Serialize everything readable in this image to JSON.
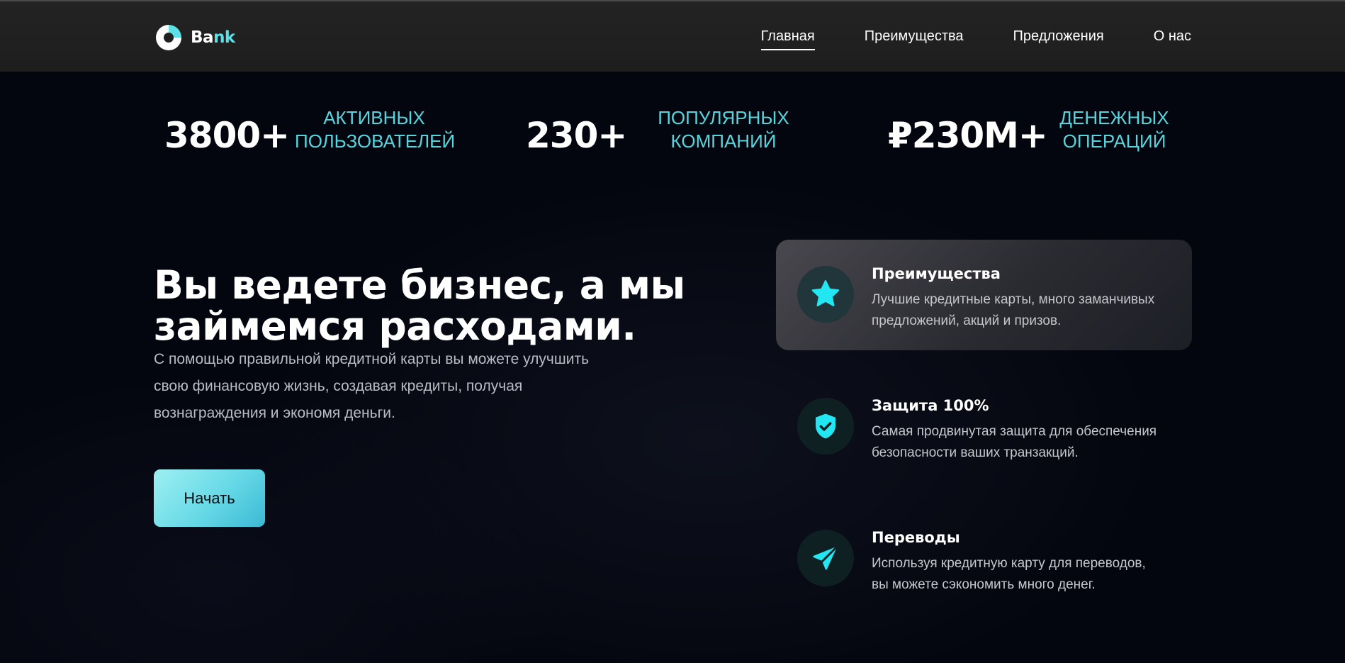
{
  "header": {
    "logo": {
      "text_part1": "Ba",
      "text_part2": "nk",
      "icon": "bank-logo-icon"
    },
    "nav": [
      {
        "label": "Главная",
        "active": true
      },
      {
        "label": "Преимущества",
        "active": false
      },
      {
        "label": "Предложения",
        "active": false
      },
      {
        "label": "О нас",
        "active": false
      }
    ]
  },
  "stats": [
    {
      "value": "3800+",
      "label_line1": "АКТИВНЫХ",
      "label_line2": "ПОЛЬЗОВАТЕЛЕЙ"
    },
    {
      "value": "230+",
      "label_line1": "ПОПУЛЯРНЫХ",
      "label_line2": "КОМПАНИЙ"
    },
    {
      "value": "₽230M+",
      "label_line1": "ДЕНЕЖНЫХ",
      "label_line2": "ОПЕРАЦИЙ"
    }
  ],
  "hero": {
    "title_line1": "Вы ведете бизнес, а мы",
    "title_line2": "займемся расходами.",
    "text_line1": "С помощью правильной кредитной карты вы можете улучшить",
    "text_line2": "свою финансовую жизнь, создавая кредиты, получая",
    "text_line3": "вознаграждения и экономя деньги.",
    "cta_label": "Начать"
  },
  "features": [
    {
      "icon": "star-icon",
      "title": "Преимущества",
      "desc_line1": "Лучшие кредитные карты, много заманчивых",
      "desc_line2": "предложений, акций и призов."
    },
    {
      "icon": "shield-check-icon",
      "title": "Защита 100%",
      "desc_line1": "Самая продвинутая защита для обеспечения",
      "desc_line2": "безопасности ваших транзакций."
    },
    {
      "icon": "send-icon",
      "title": "Переводы",
      "desc_line1": "Используя кредитную карту для переводов,",
      "desc_line2": "вы можете сэкономить много денег."
    }
  ],
  "colors": {
    "accent": "#5ce1e6",
    "background": "#04060f",
    "header_bg": "#222222"
  }
}
